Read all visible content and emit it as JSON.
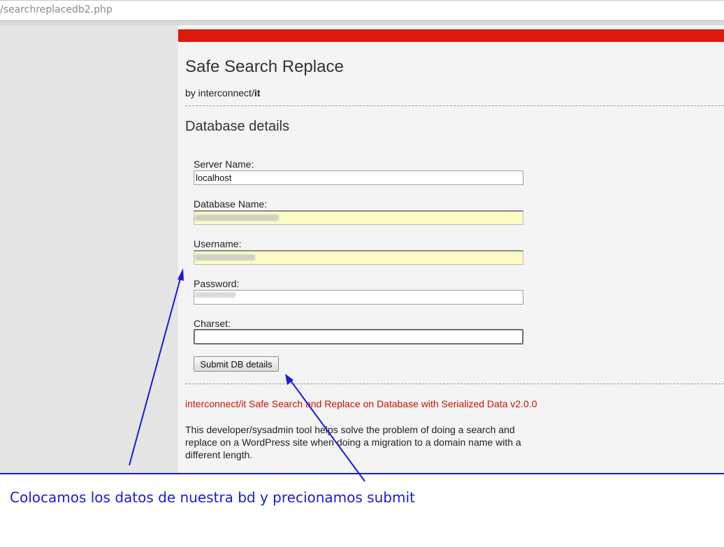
{
  "browser": {
    "url": "/searchreplacedb2.php"
  },
  "page": {
    "title": "Safe Search Replace",
    "byline_prefix": "by interconnect/",
    "byline_bold": "it",
    "section_title": "Database details"
  },
  "form": {
    "server_label": "Server Name:",
    "server_value": "localhost",
    "database_label": "Database Name:",
    "database_value": "",
    "username_label": "Username:",
    "username_value": "",
    "password_label": "Password:",
    "password_value": "",
    "charset_label": "Charset:",
    "charset_value": "",
    "submit_label": "Submit DB details"
  },
  "footer": {
    "title": "interconnect/it Safe Search and Replace on Database with Serialized Data v2.0.0",
    "description": "This developer/sysadmin tool helps solve the problem of doing a search and replace on a WordPress site when doing a migration to a domain name with a different length."
  },
  "annotation": {
    "caption": "Colocamos los datos de nuestra bd y precionamos submit",
    "color": "#1a1adc"
  },
  "colors": {
    "brand_red": "#dd1a0b",
    "footer_red": "#cc1100",
    "autofill_yellow": "#fbfdc4"
  }
}
